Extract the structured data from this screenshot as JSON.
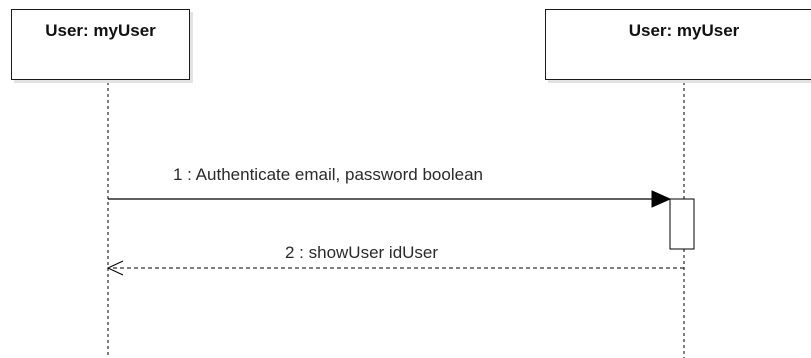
{
  "lifelines": [
    {
      "title": "User: myUser"
    },
    {
      "title": "User: myUser"
    }
  ],
  "messages": [
    {
      "number": "1",
      "label": "1 : Authenticate email, password boolean",
      "kind": "synchronous"
    },
    {
      "number": "2",
      "label": "2 : showUser idUser",
      "kind": "return"
    }
  ],
  "colors": {
    "line": "#000000",
    "text": "#2a2a2a",
    "shadow": "#e3e3e3"
  }
}
